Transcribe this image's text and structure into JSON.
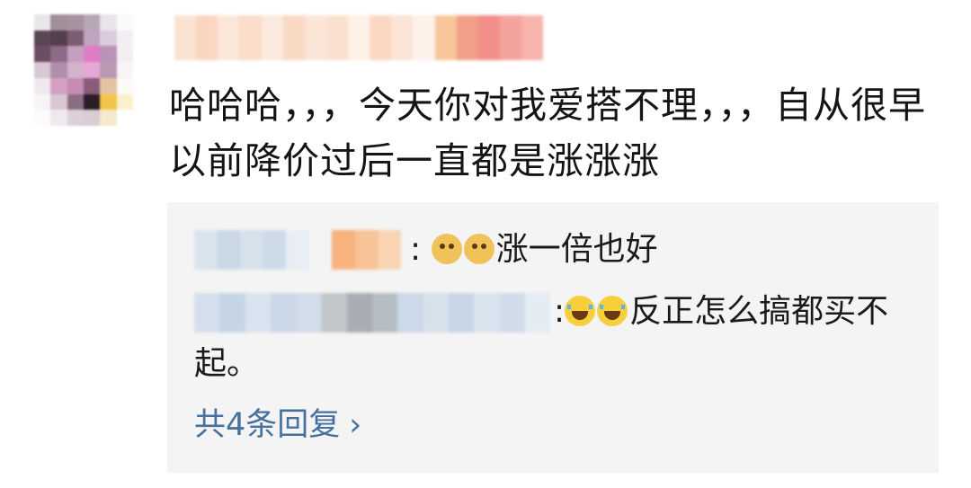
{
  "comment": {
    "text": "哈哈哈，，，今天你对我爱搭不理，，，自从很早以前降价过后一直都是涨涨涨"
  },
  "replies": [
    {
      "separator": ":",
      "emoji_icon": "doge-emoji-icon",
      "emoji_count": 2,
      "text": "涨一倍也好"
    },
    {
      "separator": ":",
      "emoji_icon": "laughing-crying-emoji-icon",
      "emoji_count": 2,
      "text": "反正怎么搞都买不起。"
    }
  ],
  "more_replies": {
    "label": "共4条回复",
    "chevron": "›"
  },
  "colors": {
    "reply_box_background": "#f4f4f4",
    "link": "#46719f",
    "text": "#141414"
  }
}
